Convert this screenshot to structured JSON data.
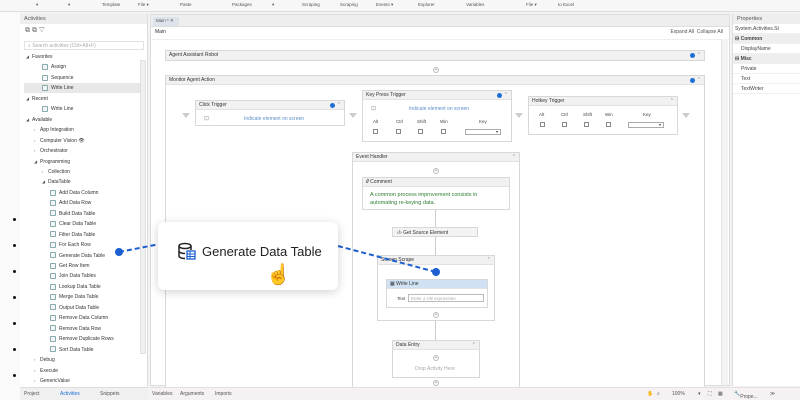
{
  "ribbon": [
    "▾",
    "▾",
    "Template",
    "File ▾",
    "Paste",
    "Packages",
    "▾",
    "Scraping",
    "Scraping",
    "Events ▾",
    "Explorer",
    "Variables",
    "File ▾",
    "to Excel"
  ],
  "activities": {
    "title": "Activities",
    "search_placeholder": "Search activities (Ctrl+Alt+F)",
    "tree": [
      {
        "label": "Favorites",
        "level": 0,
        "type": "group",
        "open": true
      },
      {
        "label": "Assign",
        "level": 2,
        "type": "item"
      },
      {
        "label": "Sequence",
        "level": 2,
        "type": "item"
      },
      {
        "label": "Write Line",
        "level": 2,
        "type": "item",
        "selected": true
      },
      {
        "label": "Recent",
        "level": 0,
        "type": "group",
        "open": true
      },
      {
        "label": "Write Line",
        "level": 2,
        "type": "item"
      },
      {
        "label": "Available",
        "level": 0,
        "type": "group",
        "open": true
      },
      {
        "label": "App Integration",
        "level": 1,
        "type": "group"
      },
      {
        "label": "Computer Vision 👁",
        "level": 1,
        "type": "group"
      },
      {
        "label": "Orchestrator",
        "level": 1,
        "type": "group"
      },
      {
        "label": "Programming",
        "level": 1,
        "type": "group",
        "open": true
      },
      {
        "label": "Collection",
        "level": 2,
        "type": "group"
      },
      {
        "label": "DataTable",
        "level": 2,
        "type": "group",
        "open": true
      },
      {
        "label": "Add Data Column",
        "level": 3,
        "type": "item"
      },
      {
        "label": "Add Data Row",
        "level": 3,
        "type": "item"
      },
      {
        "label": "Build Data Table",
        "level": 3,
        "type": "item"
      },
      {
        "label": "Clear Data Table",
        "level": 3,
        "type": "item"
      },
      {
        "label": "Filter Data Table",
        "level": 3,
        "type": "item"
      },
      {
        "label": "For Each Row",
        "level": 3,
        "type": "item"
      },
      {
        "label": "Generate Data Table",
        "level": 3,
        "type": "item"
      },
      {
        "label": "Get Row Item",
        "level": 3,
        "type": "item"
      },
      {
        "label": "Join Data Tables",
        "level": 3,
        "type": "item"
      },
      {
        "label": "Lookup Data Table",
        "level": 3,
        "type": "item"
      },
      {
        "label": "Merge Data Table",
        "level": 3,
        "type": "item"
      },
      {
        "label": "Output Data Table",
        "level": 3,
        "type": "item"
      },
      {
        "label": "Remove Data Column",
        "level": 3,
        "type": "item"
      },
      {
        "label": "Remove Data Row",
        "level": 3,
        "type": "item"
      },
      {
        "label": "Remove Duplicate Rows",
        "level": 3,
        "type": "item"
      },
      {
        "label": "Sort Data Table",
        "level": 3,
        "type": "item"
      },
      {
        "label": "Debug",
        "level": 1,
        "type": "group"
      },
      {
        "label": "Execute",
        "level": 1,
        "type": "group"
      },
      {
        "label": "GenericValue",
        "level": 1,
        "type": "group"
      }
    ],
    "bottom_tabs": [
      "Project",
      "Activities",
      "Snippets"
    ]
  },
  "designer": {
    "tab": "Main *  ✕",
    "breadcrumb": "Main",
    "expand_all": "Expand All",
    "collapse_all": "Collapse All",
    "agent_robot": "Agent Assistant Robot",
    "monitor": "Monitor Agent Action",
    "click_trigger": "Click Trigger",
    "indicate": "Indicate element on screen",
    "key_press": "Key Press Trigger",
    "hotkey": "Hotkey Trigger",
    "mods": [
      "Alt",
      "Ctrl",
      "Shift",
      "Win"
    ],
    "key": "Key",
    "event_handler": "Event Handler",
    "comment_title": "Comment",
    "comment_text": "A common process improvement consists in automating re-keying data.",
    "get_source": "Get Source Element",
    "screen_scrape": "Screen Scrape",
    "write_line": "Write Line",
    "text_label": "Text",
    "text_placeholder": "Enter a VB expression",
    "data_entry": "Data Entry",
    "drop": "Drop Activity Here"
  },
  "status": {
    "tabs": [
      "Variables",
      "Arguments",
      "Imports"
    ],
    "zoom": "100%",
    "props_tab": "Prope..."
  },
  "properties": {
    "title": "Properties",
    "type": "System.Activities.St",
    "common": "Common",
    "display_name": "DisplayName",
    "misc": "Misc",
    "private": "Private",
    "text": "Text",
    "textwriter": "TextWriter"
  },
  "callout": {
    "label": "Generate Data Table"
  },
  "colors": {
    "accent": "#1c5fd0",
    "comment": "#2e7d32"
  }
}
